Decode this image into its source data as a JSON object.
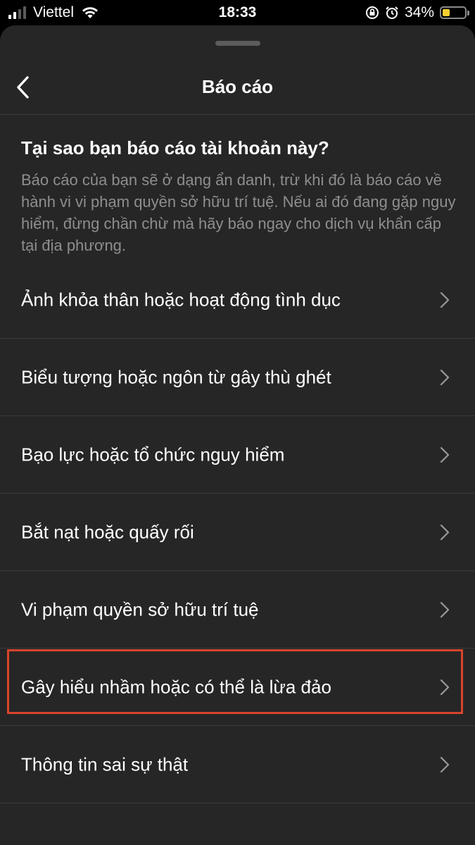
{
  "status_bar": {
    "carrier": "Viettel",
    "time": "18:33",
    "battery_percent": "34%",
    "battery_level": 0.34,
    "icons": [
      "cellular-signal-icon",
      "wifi-icon",
      "orientation-lock-icon",
      "alarm-icon",
      "battery-icon"
    ],
    "colors": {
      "battery_fill": "#f6d02e"
    }
  },
  "header": {
    "title": "Báo cáo",
    "back_icon": "chevron-left-icon"
  },
  "intro": {
    "question": "Tại sao bạn báo cáo tài khoản này?",
    "description": "Báo cáo của bạn sẽ ở dạng ẩn danh, trừ khi đó là báo cáo về hành vi vi phạm quyền sở hữu trí tuệ. Nếu ai đó đang gặp nguy hiểm, đừng chần chừ mà hãy báo ngay cho dịch vụ khẩn cấp tại địa phương."
  },
  "options": [
    {
      "label": "Ảnh khỏa thân hoặc hoạt động tình dục"
    },
    {
      "label": "Biểu tượng hoặc ngôn từ gây thù ghét"
    },
    {
      "label": "Bạo lực hoặc tổ chức nguy hiểm"
    },
    {
      "label": "Bắt nạt hoặc quấy rối"
    },
    {
      "label": "Vi phạm quyền sở hữu trí tuệ"
    },
    {
      "label": "Gây hiểu nhầm hoặc có thể là lừa đảo",
      "highlighted": true
    },
    {
      "label": "Thông tin sai sự thật"
    }
  ],
  "colors": {
    "sheet_background": "#262626",
    "highlight_border": "#d9442b",
    "secondary_text": "#8e8e8e"
  }
}
